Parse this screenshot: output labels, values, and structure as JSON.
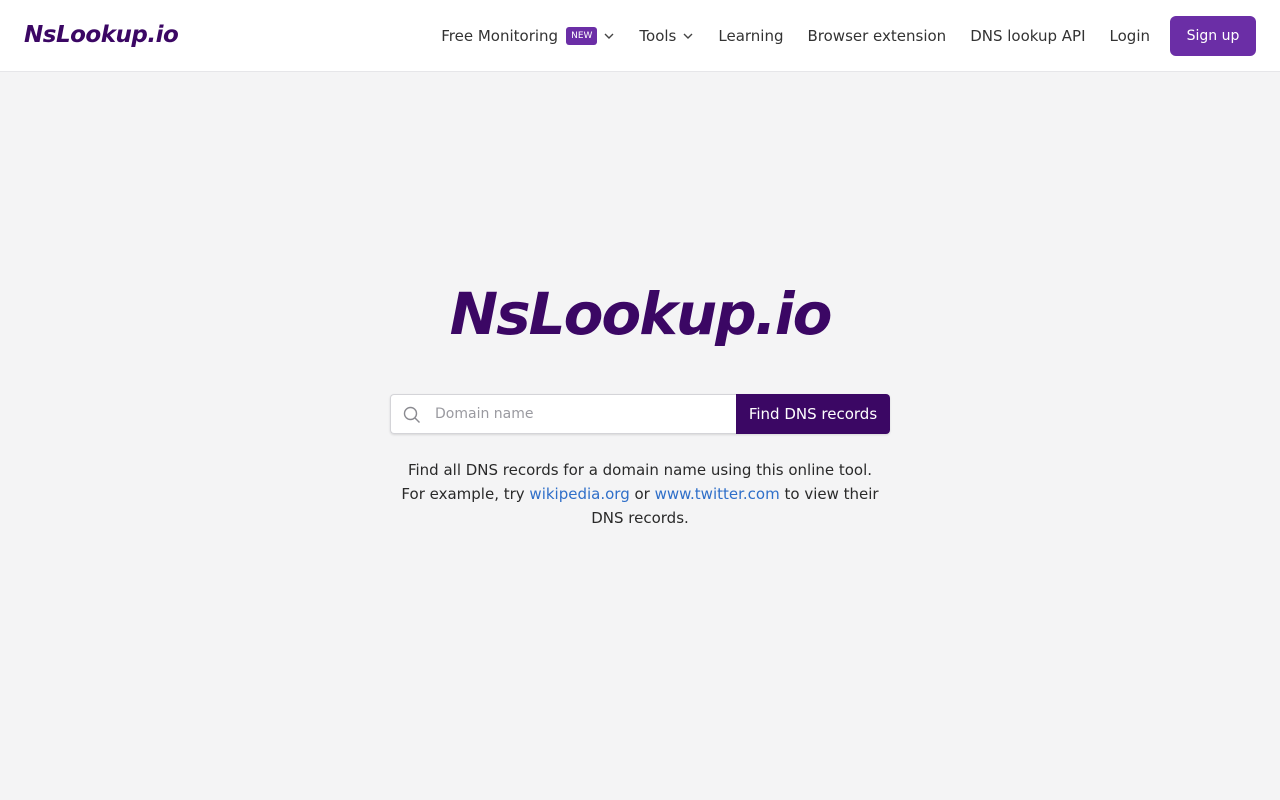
{
  "header": {
    "logo": "NsLookup.io",
    "nav": {
      "free_monitoring": "Free Monitoring",
      "new_badge": "NEW",
      "tools": "Tools",
      "learning": "Learning",
      "browser_extension": "Browser extension",
      "dns_api": "DNS lookup API",
      "login": "Login",
      "signup": "Sign up"
    }
  },
  "hero": {
    "title": "NsLookup.io",
    "search": {
      "placeholder": "Domain name",
      "value": "",
      "button": "Find DNS records"
    },
    "description": {
      "part1": "Find all DNS records for a domain name using this online tool. For example, try ",
      "link1": "wikipedia.org",
      "part2": " or ",
      "link2": "www.twitter.com",
      "part3": " to view their DNS records."
    }
  },
  "colors": {
    "brand": "#3b0764",
    "accent": "#6b2ea6",
    "link": "#2f6fc9",
    "background": "#f4f4f5"
  },
  "icons": [
    "chevron-down-icon",
    "search-icon"
  ]
}
